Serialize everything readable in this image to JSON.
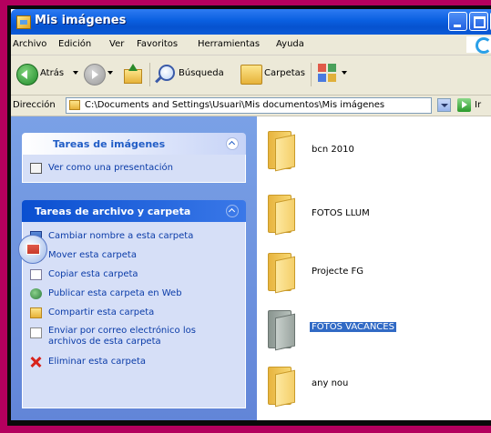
{
  "window": {
    "title": "Mis imágenes"
  },
  "menu": [
    "Archivo",
    "Edición",
    "Ver",
    "Favoritos",
    "Herramientas",
    "Ayuda"
  ],
  "toolbar": {
    "back_label": "Atrás",
    "search_label": "Búsqueda",
    "folders_label": "Carpetas"
  },
  "address": {
    "label": "Dirección",
    "path": "C:\\Documents and Settings\\Usuari\\Mis documentos\\Mis imágenes",
    "go_label": "Ir"
  },
  "task_pane": {
    "image_tasks": {
      "title": "Tareas de imágenes",
      "items": [
        "Ver como una presentación"
      ]
    },
    "file_tasks": {
      "title": "Tareas de archivo y carpeta",
      "items": [
        "Cambiar nombre a esta carpeta",
        "Mover esta carpeta",
        "Copiar esta carpeta",
        "Publicar esta carpeta en Web",
        "Compartir esta carpeta",
        "Enviar por correo electrónico los",
        "archivos de esta carpeta",
        "Eliminar esta carpeta"
      ]
    }
  },
  "folders": [
    {
      "name": "bcn 2010",
      "selected": false
    },
    {
      "name": "FOTOS LLUM",
      "selected": false
    },
    {
      "name": "Projecte FG",
      "selected": false
    },
    {
      "name": "FOTOS VACANCES",
      "selected": true
    },
    {
      "name": "any nou",
      "selected": false
    }
  ],
  "colors": {
    "frame_border": "#b4005e",
    "titlebar": "#0a5fe0",
    "taskpane": "#6e93dd",
    "selection": "#316ac5"
  }
}
